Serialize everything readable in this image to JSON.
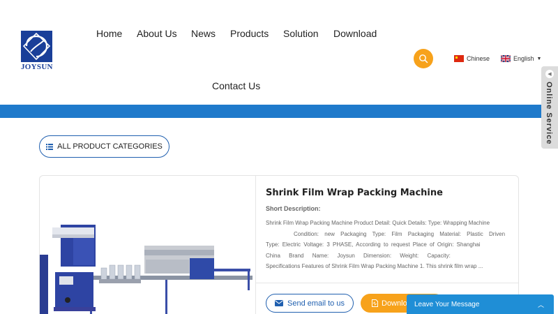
{
  "brand": {
    "name": "JOYSUN"
  },
  "nav": {
    "items": [
      "Home",
      "About Us",
      "News",
      "Products",
      "Solution",
      "Download"
    ],
    "contact": "Contact Us"
  },
  "languages": {
    "chinese": "Chinese",
    "english": "English"
  },
  "categories_button": "ALL PRODUCT CATEGORIES",
  "product": {
    "title": "Shrink Film Wrap Packing Machine",
    "short_description_label": "Short Description:",
    "description_lines": [
      "Shrink Film Wrap Packing Machine Product Detail: Quick Details: Type: Wrapping Machine",
      "Condition: new Packaging Type: Film Packaging Material: Plastic Driven",
      "Type: Electric Voltage: 3 PHASE, According to request Place of Origin: Shanghai",
      "China Brand Name: Joysun Dimension: Weight: Capacity:",
      "Specifications Features of Shrink Film Wrap Packing Machine 1. This shrink film wrap ..."
    ],
    "email_button": "Send email to us",
    "download_button": "Download"
  },
  "online_service": "Online Service",
  "leave_message": "Leave Your Message",
  "colors": {
    "brand_blue": "#1a3f99",
    "bar_blue": "#1f7acb",
    "accent_orange": "#f7a21b",
    "chat_blue": "#1f8ed6"
  }
}
